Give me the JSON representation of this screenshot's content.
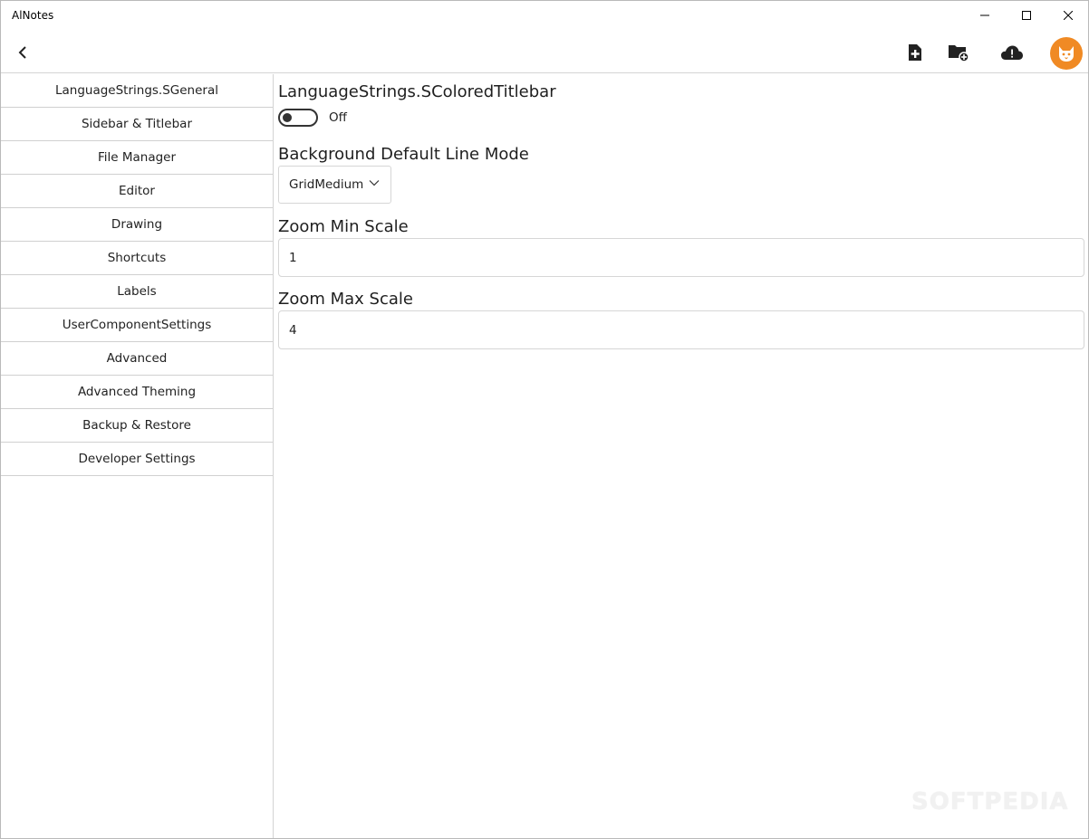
{
  "app": {
    "title": "AlNotes"
  },
  "window_controls": {
    "minimize": "minimize-icon",
    "maximize": "maximize-icon",
    "close": "close-icon"
  },
  "toolbar": {
    "back": "back-arrow-icon",
    "new_file": "new-file-icon",
    "new_folder": "new-folder-icon",
    "cloud_sync": "cloud-alert-icon",
    "avatar": "cat-avatar-icon",
    "avatar_color": "#f08a24"
  },
  "sidebar": {
    "items": [
      {
        "label": "LanguageStrings.SGeneral"
      },
      {
        "label": "Sidebar & Titlebar"
      },
      {
        "label": "File Manager"
      },
      {
        "label": "Editor"
      },
      {
        "label": "Drawing"
      },
      {
        "label": "Shortcuts"
      },
      {
        "label": "Labels"
      },
      {
        "label": "UserComponentSettings"
      },
      {
        "label": "Advanced"
      },
      {
        "label": "Advanced Theming"
      },
      {
        "label": "Backup & Restore"
      },
      {
        "label": "Developer Settings"
      }
    ]
  },
  "settings": {
    "colored_titlebar": {
      "title": "LanguageStrings.SColoredTitlebar",
      "state": "Off"
    },
    "line_mode": {
      "title": "Background Default Line Mode",
      "value": "GridMedium"
    },
    "zoom_min": {
      "title": "Zoom Min Scale",
      "value": "1"
    },
    "zoom_max": {
      "title": "Zoom Max Scale",
      "value": "4"
    }
  },
  "watermark": "SOFTPEDIA"
}
